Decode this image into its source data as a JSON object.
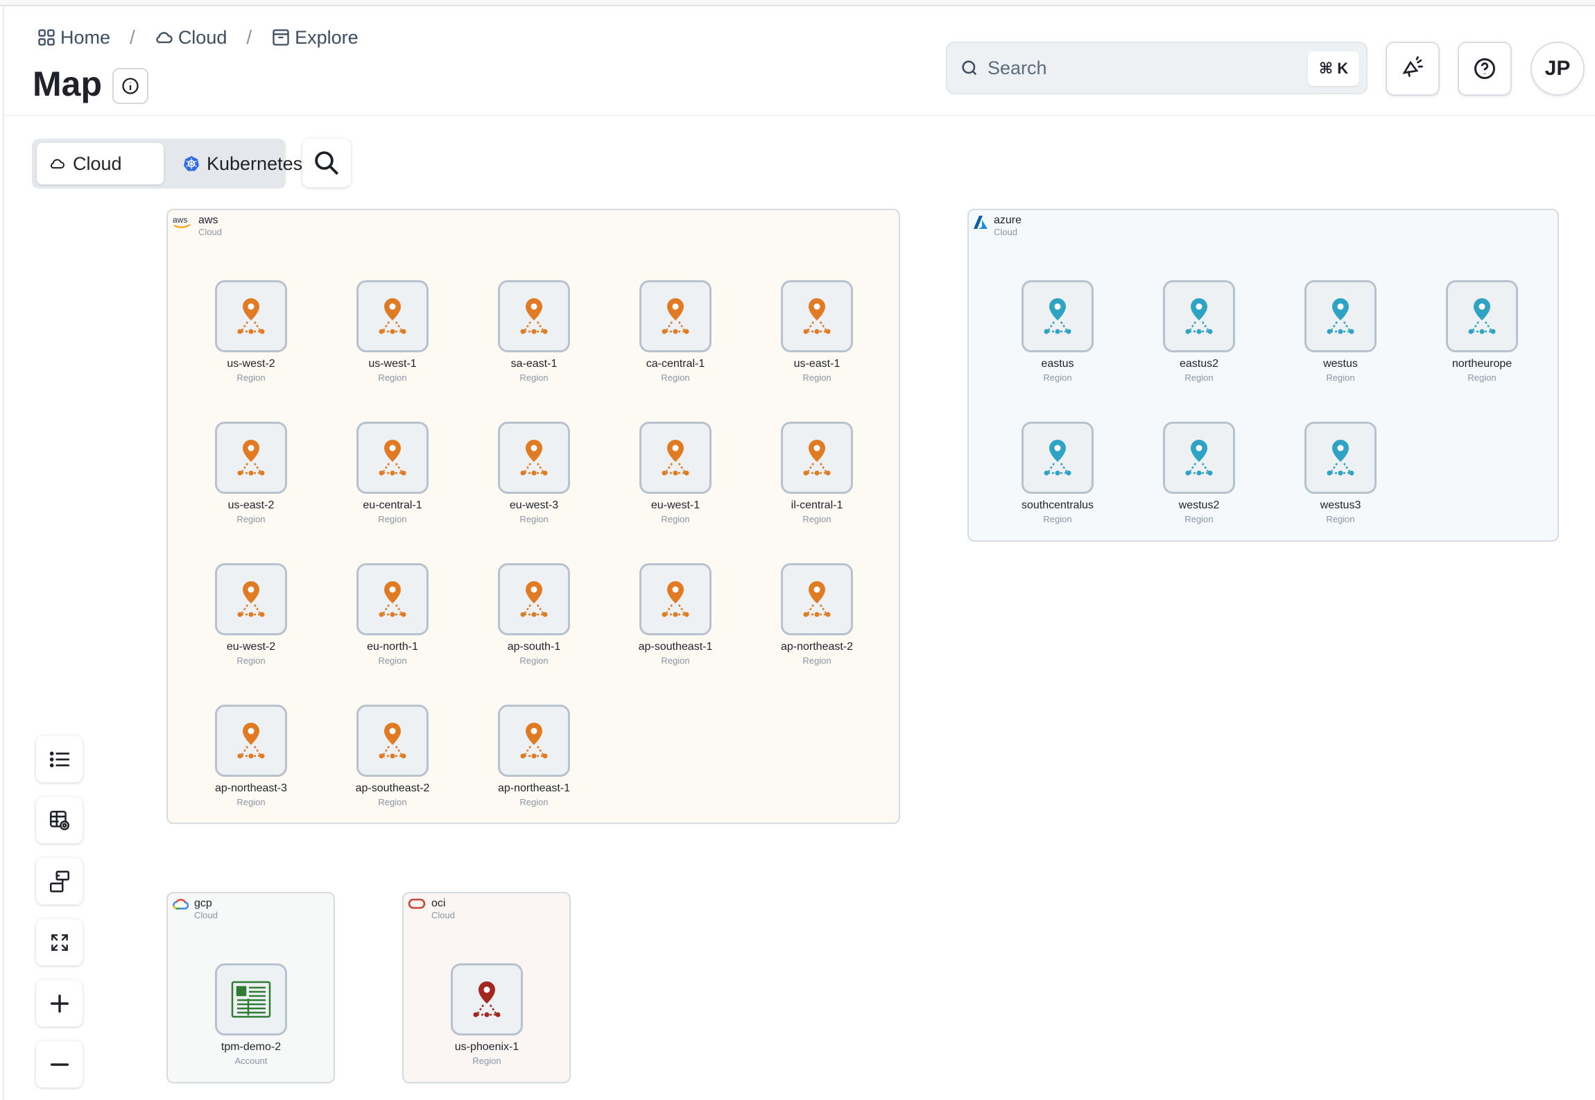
{
  "breadcrumb": {
    "home": "Home",
    "cloud": "Cloud",
    "explore": "Explore",
    "separator": "/"
  },
  "page": {
    "title": "Map"
  },
  "search": {
    "placeholder": "Search",
    "shortcut": "⌘ K"
  },
  "user": {
    "initials": "JP"
  },
  "view_toggle": {
    "cloud": "Cloud",
    "kubernetes": "Kubernetes",
    "selected": "Cloud"
  },
  "colors": {
    "aws": "#e07b24",
    "azure": "#2ea3c4",
    "gcp": "#2e7d32",
    "oci": "#a3271f"
  },
  "groups": {
    "aws": {
      "name": "aws",
      "type": "Cloud",
      "regions": [
        {
          "label": "us-west-2",
          "type": "Region"
        },
        {
          "label": "us-west-1",
          "type": "Region"
        },
        {
          "label": "sa-east-1",
          "type": "Region"
        },
        {
          "label": "ca-central-1",
          "type": "Region"
        },
        {
          "label": "us-east-1",
          "type": "Region"
        },
        {
          "label": "us-east-2",
          "type": "Region"
        },
        {
          "label": "eu-central-1",
          "type": "Region"
        },
        {
          "label": "eu-west-3",
          "type": "Region"
        },
        {
          "label": "eu-west-1",
          "type": "Region"
        },
        {
          "label": "il-central-1",
          "type": "Region"
        },
        {
          "label": "eu-west-2",
          "type": "Region"
        },
        {
          "label": "eu-north-1",
          "type": "Region"
        },
        {
          "label": "ap-south-1",
          "type": "Region"
        },
        {
          "label": "ap-southeast-1",
          "type": "Region"
        },
        {
          "label": "ap-northeast-2",
          "type": "Region"
        },
        {
          "label": "ap-northeast-3",
          "type": "Region"
        },
        {
          "label": "ap-southeast-2",
          "type": "Region"
        },
        {
          "label": "ap-northeast-1",
          "type": "Region"
        }
      ]
    },
    "azure": {
      "name": "azure",
      "type": "Cloud",
      "regions": [
        {
          "label": "eastus",
          "type": "Region"
        },
        {
          "label": "eastus2",
          "type": "Region"
        },
        {
          "label": "westus",
          "type": "Region"
        },
        {
          "label": "northeurope",
          "type": "Region"
        },
        {
          "label": "southcentralus",
          "type": "Region"
        },
        {
          "label": "westus2",
          "type": "Region"
        },
        {
          "label": "westus3",
          "type": "Region"
        }
      ]
    },
    "gcp": {
      "name": "gcp",
      "type": "Cloud",
      "nodes": [
        {
          "label": "tpm-demo-2",
          "type": "Account"
        }
      ]
    },
    "oci": {
      "name": "oci",
      "type": "Cloud",
      "nodes": [
        {
          "label": "us-phoenix-1",
          "type": "Region"
        }
      ]
    }
  }
}
